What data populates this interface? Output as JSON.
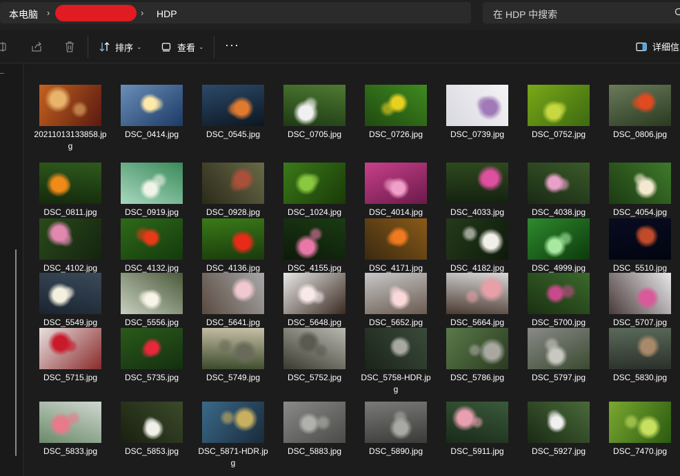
{
  "address": {
    "crumbs": [
      "本电脑",
      "HDP"
    ],
    "separator": "›",
    "search_placeholder": "在 HDP 中搜索"
  },
  "toolbar": {
    "sort_label": "排序",
    "view_label": "查看",
    "more_label": "···",
    "details_label": "详细信息"
  },
  "files": [
    {
      "name": "20211013133858.jpg",
      "icon": "image-thumbnail",
      "colors": [
        "#c4621f",
        "#5a1a10",
        "#e8b36a"
      ]
    },
    {
      "name": "DSC_0414.jpg",
      "icon": "image-thumbnail",
      "colors": [
        "#6a8fb8",
        "#1c3a66",
        "#ffe9a8"
      ]
    },
    {
      "name": "DSC_0545.jpg",
      "icon": "image-thumbnail",
      "colors": [
        "#2c4a6a",
        "#0c1620",
        "#e07a30"
      ]
    },
    {
      "name": "DSC_0705.jpg",
      "icon": "image-thumbnail",
      "colors": [
        "#4e7a32",
        "#1e3a14",
        "#f0f0f0"
      ]
    },
    {
      "name": "DSC_0726.jpg",
      "icon": "image-thumbnail",
      "colors": [
        "#3f8a20",
        "#1f4a10",
        "#e8d020"
      ]
    },
    {
      "name": "DSC_0739.jpg",
      "icon": "image-thumbnail",
      "colors": [
        "#f4f4f6",
        "#d8d8e0",
        "#a07ab8"
      ]
    },
    {
      "name": "DSC_0752.jpg",
      "icon": "image-thumbnail",
      "colors": [
        "#7aa818",
        "#3c6a10",
        "#c8d840"
      ]
    },
    {
      "name": "DSC_0806.jpg",
      "icon": "image-thumbnail",
      "colors": [
        "#6a7a5a",
        "#2a3a20",
        "#e04a20"
      ]
    },
    {
      "name": "DSC_0811.jpg",
      "icon": "image-thumbnail",
      "colors": [
        "#2e5a1c",
        "#142a0c",
        "#f08a18"
      ]
    },
    {
      "name": "DSC_0919.jpg",
      "icon": "image-thumbnail",
      "colors": [
        "#3a8a5a",
        "#a8d8c0",
        "#f0f4e8"
      ]
    },
    {
      "name": "DSC_0928.jpg",
      "icon": "image-thumbnail",
      "colors": [
        "#6a6a48",
        "#2a2a1a",
        "#a8503a"
      ]
    },
    {
      "name": "DSC_1024.jpg",
      "icon": "image-thumbnail",
      "colors": [
        "#3a7a18",
        "#1a3a08",
        "#8ac840"
      ]
    },
    {
      "name": "DSC_4014.jpg",
      "icon": "image-thumbnail",
      "colors": [
        "#c8408a",
        "#6a1a4a",
        "#f0a0c8"
      ]
    },
    {
      "name": "DSC_4033.jpg",
      "icon": "image-thumbnail",
      "colors": [
        "#2e4a1e",
        "#142010",
        "#e050a0"
      ]
    },
    {
      "name": "DSC_4038.jpg",
      "icon": "image-thumbnail",
      "colors": [
        "#3a5a2a",
        "#1a2a14",
        "#e8a0c8"
      ]
    },
    {
      "name": "DSC_4054.jpg",
      "icon": "image-thumbnail",
      "colors": [
        "#3e7a2a",
        "#1c3a12",
        "#f4e8d0"
      ]
    },
    {
      "name": "DSC_4102.jpg",
      "icon": "image-thumbnail",
      "colors": [
        "#2a4a1a",
        "#142410",
        "#e088b0"
      ]
    },
    {
      "name": "DSC_4132.jpg",
      "icon": "image-thumbnail",
      "colors": [
        "#2e6a1a",
        "#143a0c",
        "#e83a18"
      ]
    },
    {
      "name": "DSC_4136.jpg",
      "icon": "image-thumbnail",
      "colors": [
        "#3a7a18",
        "#1a3a0c",
        "#e82a18"
      ]
    },
    {
      "name": "DSC_4155.jpg",
      "icon": "image-thumbnail",
      "colors": [
        "#1a3a14",
        "#0c1a08",
        "#e878a8"
      ]
    },
    {
      "name": "DSC_4171.jpg",
      "icon": "image-thumbnail",
      "colors": [
        "#8a5a18",
        "#3a2a10",
        "#f07a20"
      ]
    },
    {
      "name": "DSC_4182.jpg",
      "icon": "image-thumbnail",
      "colors": [
        "#243a1a",
        "#0e1a0a",
        "#f0f0e8"
      ]
    },
    {
      "name": "DSC_4999.jpg",
      "icon": "image-thumbnail",
      "colors": [
        "#2e8a2e",
        "#0c3a0c",
        "#a8e8a0"
      ]
    },
    {
      "name": "DSC_5510.jpg",
      "icon": "image-thumbnail",
      "colors": [
        "#080c20",
        "#020410",
        "#c04a2a"
      ]
    },
    {
      "name": "DSC_5549.jpg",
      "icon": "image-thumbnail",
      "colors": [
        "#3a4a5a",
        "#1a2430",
        "#f4f0e0"
      ]
    },
    {
      "name": "DSC_5556.jpg",
      "icon": "image-thumbnail",
      "colors": [
        "#4a5a3a",
        "#c8d0c0",
        "#f8f4e8"
      ]
    },
    {
      "name": "DSC_5641.jpg",
      "icon": "image-thumbnail",
      "colors": [
        "#a8a8a8",
        "#5a4a40",
        "#f0c8d0"
      ]
    },
    {
      "name": "DSC_5648.jpg",
      "icon": "image-thumbnail",
      "colors": [
        "#e8e8e8",
        "#3a2a20",
        "#f8e8e8"
      ]
    },
    {
      "name": "DSC_5652.jpg",
      "icon": "image-thumbnail",
      "colors": [
        "#c8c8c8",
        "#6a5a50",
        "#f8d8d8"
      ]
    },
    {
      "name": "DSC_5664.jpg",
      "icon": "image-thumbnail",
      "colors": [
        "#d8d8d8",
        "#4a3a30",
        "#e8a0a8"
      ]
    },
    {
      "name": "DSC_5700.jpg",
      "icon": "image-thumbnail",
      "colors": [
        "#3a6a2a",
        "#1a3012",
        "#c84a8a"
      ]
    },
    {
      "name": "DSC_5707.jpg",
      "icon": "image-thumbnail",
      "colors": [
        "#e8e8ea",
        "#4a3a3a",
        "#d85a9a"
      ]
    },
    {
      "name": "DSC_5715.jpg",
      "icon": "image-thumbnail",
      "colors": [
        "#e8e0e0",
        "#8a2a2a",
        "#c81a2a"
      ]
    },
    {
      "name": "DSC_5735.jpg",
      "icon": "image-thumbnail",
      "colors": [
        "#2a5a1a",
        "#143010",
        "#e8283a"
      ]
    },
    {
      "name": "DSC_5749.jpg",
      "icon": "image-thumbnail",
      "colors": [
        "#c8c0a8",
        "#3a4a2a",
        "#6a6a5a"
      ]
    },
    {
      "name": "DSC_5752.jpg",
      "icon": "image-thumbnail",
      "colors": [
        "#b8b8b0",
        "#3a3a30",
        "#5a5a50"
      ]
    },
    {
      "name": "DSC_5758-HDR.jpg",
      "icon": "image-thumbnail",
      "colors": [
        "#3a4a3a",
        "#1a2418",
        "#a8a8a0"
      ]
    },
    {
      "name": "DSC_5786.jpg",
      "icon": "image-thumbnail",
      "colors": [
        "#5a7a4a",
        "#2a3a20",
        "#a8a8a0"
      ]
    },
    {
      "name": "DSC_5797.jpg",
      "icon": "image-thumbnail",
      "colors": [
        "#8a8a88",
        "#3a4a30",
        "#c8c8c0"
      ]
    },
    {
      "name": "DSC_5830.jpg",
      "icon": "image-thumbnail",
      "colors": [
        "#5a6a5a",
        "#2a302a",
        "#a88a6a"
      ]
    },
    {
      "name": "DSC_5833.jpg",
      "icon": "image-thumbnail",
      "colors": [
        "#d0d8d0",
        "#6a8a6a",
        "#e87a8a"
      ]
    },
    {
      "name": "DSC_5853.jpg",
      "icon": "image-thumbnail",
      "colors": [
        "#3a4a2a",
        "#1a2010",
        "#f0f0e8"
      ]
    },
    {
      "name": "DSC_5871-HDR.jpg",
      "icon": "image-thumbnail",
      "colors": [
        "#3a6a8a",
        "#1a2a3a",
        "#c8b060"
      ]
    },
    {
      "name": "DSC_5883.jpg",
      "icon": "image-thumbnail",
      "colors": [
        "#8a8a88",
        "#4a4a48",
        "#b0b0ac"
      ]
    },
    {
      "name": "DSC_5890.jpg",
      "icon": "image-thumbnail",
      "colors": [
        "#7a7a78",
        "#3a3a38",
        "#a8a8a4"
      ]
    },
    {
      "name": "DSC_5911.jpg",
      "icon": "image-thumbnail",
      "colors": [
        "#3a5a3a",
        "#1a2a1a",
        "#e8a0b0"
      ]
    },
    {
      "name": "DSC_5927.jpg",
      "icon": "image-thumbnail",
      "colors": [
        "#4a6a3a",
        "#1a2a14",
        "#f0f0f0"
      ]
    },
    {
      "name": "DSC_7470.jpg",
      "icon": "image-thumbnail",
      "colors": [
        "#7aa830",
        "#2a5a10",
        "#c8e060"
      ]
    }
  ],
  "colors": {
    "window_bg": "#1c1c1c",
    "bar_bg": "#2b2b2b",
    "redaction": "#e01b22",
    "text": "#ffffff",
    "accent": "#4aa8e8"
  }
}
